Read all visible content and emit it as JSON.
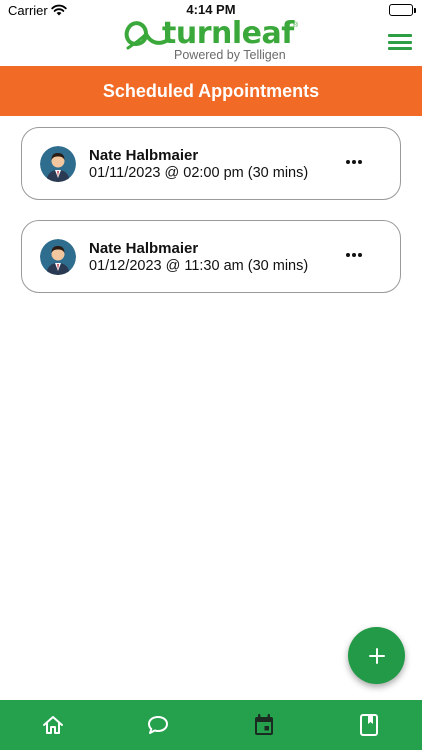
{
  "status_bar": {
    "carrier": "Carrier",
    "time": "4:14 PM",
    "battery_level": 1.0
  },
  "header": {
    "logo_text": "turnleaf",
    "logo_registered": "®",
    "logo_subtitle": "Powered by Telligen",
    "menu_icon": "hamburger-menu-icon"
  },
  "page": {
    "title": "Scheduled Appointments"
  },
  "appointments": [
    {
      "name": "Nate Halbmaier",
      "datetime": "01/11/2023 @ 02:00 pm (30 mins)",
      "avatar_icon": "user-avatar-icon",
      "more_icon": "ellipsis-icon"
    },
    {
      "name": "Nate Halbmaier",
      "datetime": "01/12/2023 @ 11:30 am (30 mins)",
      "avatar_icon": "user-avatar-icon",
      "more_icon": "ellipsis-icon"
    }
  ],
  "fab": {
    "icon": "plus-icon"
  },
  "bottom_nav": {
    "items": [
      {
        "icon": "home-icon"
      },
      {
        "icon": "chat-bubble-icon"
      },
      {
        "icon": "calendar-icon",
        "active": true
      },
      {
        "icon": "book-icon"
      }
    ]
  },
  "colors": {
    "brand_green": "#2e9e45",
    "header_orange": "#f26b26",
    "nav_green": "#25a04c"
  }
}
